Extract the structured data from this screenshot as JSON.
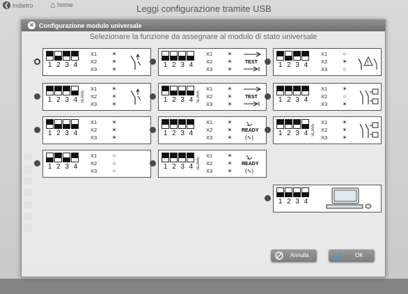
{
  "nav": {
    "back_label": "indietro",
    "home_label": "home"
  },
  "page": {
    "title": "Leggi configurazione tramite USB"
  },
  "dialog": {
    "title": "Configurazione modulo universale",
    "subtitle": "Selezionare la funzione da assegnare al modulo di stato universale",
    "cancel_label": "Annulla",
    "ok_label": "OK"
  },
  "dip_numbers": [
    "1",
    "2",
    "3",
    "4"
  ],
  "x_labels": [
    "X1",
    "X2",
    "X3"
  ],
  "slave_label": "SLAVE",
  "test_label": "TEST",
  "ready_label": "READY",
  "options": [
    {
      "id": "opt-1",
      "selected": true,
      "dips": [
        "up",
        "dn",
        "up",
        "up"
      ],
      "slave": false,
      "syms": [
        "☀",
        "☀",
        "☀"
      ],
      "icon": "switch-arrows"
    },
    {
      "id": "opt-2",
      "selected": false,
      "dips": [
        "dn",
        "dn",
        "dn",
        "dn"
      ],
      "slave": false,
      "syms": [
        "☀",
        "☀",
        "☀"
      ],
      "icon": "test-lines"
    },
    {
      "id": "opt-3",
      "selected": false,
      "dips": [
        "up",
        "dn",
        "up",
        "up"
      ],
      "slave": false,
      "syms": [
        "○",
        "☀",
        "○"
      ],
      "icon": "switch-warning"
    },
    {
      "id": "opt-4",
      "selected": false,
      "dips": [
        "up",
        "up",
        "up",
        "dn"
      ],
      "slave": true,
      "syms": [
        "☀",
        "☀",
        "☀"
      ],
      "icon": "switch-arrows"
    },
    {
      "id": "opt-5",
      "selected": false,
      "dips": [
        "up",
        "dn",
        "dn",
        "dn"
      ],
      "slave": true,
      "syms": [
        "☀",
        "☀",
        "☀"
      ],
      "icon": "test-lines"
    },
    {
      "id": "opt-6",
      "selected": false,
      "dips": [
        "up",
        "up",
        "up",
        "up"
      ],
      "slave": false,
      "syms": [
        "☀",
        "○",
        "☀"
      ],
      "icon": "double-switch"
    },
    {
      "id": "opt-7",
      "selected": false,
      "dips": [
        "up",
        "dn",
        "dn",
        "dn"
      ],
      "slave": false,
      "syms": [
        "☀",
        "☀",
        "☀"
      ],
      "icon": "none"
    },
    {
      "id": "opt-8",
      "selected": false,
      "dips": [
        "up",
        "up",
        "up",
        "up"
      ],
      "slave": false,
      "syms": [
        "☀",
        "☀",
        "☀"
      ],
      "icon": "ready"
    },
    {
      "id": "opt-9",
      "selected": false,
      "dips": [
        "up",
        "up",
        "up",
        "dn"
      ],
      "slave": true,
      "syms": [
        "☀",
        "☀",
        "☀"
      ],
      "icon": "double-switch"
    },
    {
      "id": "opt-10",
      "selected": false,
      "dips": [
        "dn",
        "up",
        "dn",
        "up"
      ],
      "slave": false,
      "syms": [
        "○",
        "○",
        "○"
      ],
      "icon": "none"
    },
    {
      "id": "opt-11",
      "selected": false,
      "dips": [
        "up",
        "up",
        "up",
        "up"
      ],
      "slave": true,
      "syms": [
        "☀",
        "☀",
        "☀"
      ],
      "icon": "ready"
    },
    {
      "id": "opt-12",
      "selected": false,
      "dips": [
        "dn",
        "dn",
        "dn",
        "dn"
      ],
      "slave": false,
      "syms": [],
      "icon": "computer"
    }
  ]
}
